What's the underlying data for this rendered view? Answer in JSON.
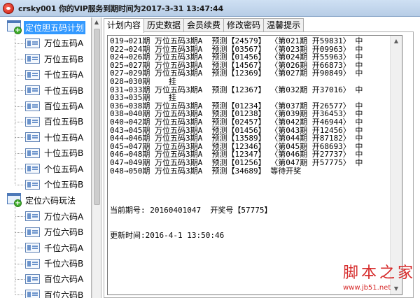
{
  "window": {
    "title": "crsky001 你的VIP服务到期时间为2017-3-31 13:47:44",
    "icon": "app-logo-icon"
  },
  "tree": {
    "groups": [
      {
        "label": "定位胆五码计划",
        "selected": true,
        "items": [
          "万位五码A",
          "万位五码B",
          "千位五码A",
          "千位五码B",
          "百位五码A",
          "百位五码B",
          "十位五码A",
          "十位五码B",
          "个位五码A",
          "个位五码B"
        ]
      },
      {
        "label": "定位六码玩法",
        "selected": false,
        "items": [
          "万位六码A",
          "万位六码B",
          "千位六码A",
          "千位六码B",
          "百位六码A",
          "百位六码B"
        ]
      }
    ]
  },
  "tabs": [
    "计划内容",
    "历史数据",
    "会员续费",
    "修改密码",
    "温馨提示"
  ],
  "plan": {
    "lines": [
      "019→021期 万位五码3期A  预测【24579】 〈第021期 开59831〉 中",
      "022→024期 万位五码3期A  预测【03567】 〈第023期 开09963〉 中",
      "024→026期 万位五码3期A  预测【01456】 〈第024期 开55963〉 中",
      "025→027期 万位五码3期A  预测【14567】 〈第026期 开66873〉 中",
      "027→029期 万位五码3期A  预测【12369】 〈第027期 开90849〉 中",
      "028→030期    挂",
      "031→033期 万位五码3期A  预测【12367】 〈第032期 开37016〉 中",
      "033→035期    挂",
      "036→038期 万位五码3期A  预测【01234】 〈第037期 开26577〉 中",
      "038→040期 万位五码3期A  预测【01238】 〈第039期 开36453〉 中",
      "040→042期 万位五码3期A  预测【02457】 〈第042期 开46944〉 中",
      "043→045期 万位五码3期A  预测【01456】 〈第043期 开12456〉 中",
      "044→046期 万位五码3期A  预测【13589】 〈第044期 开87182〉 中",
      "045→047期 万位五码3期A  预测【12346】 〈第045期 开68693〉 中",
      "046→048期 万位五码3期A  预测【12347】 〈第046期 开27737〉 中",
      "047→049期 万位五码3期A  预测【01256】 〈第047期 开57775〉 中",
      "048→050期 万位五码3期A  预测【34689】 等待开奖"
    ],
    "current_issue": "当前期号: 20160401047  开奖号【57775】",
    "update_time": "更新时间:2016-4-1 13:50:46"
  },
  "watermark": {
    "text": "脚本之家",
    "url": "www.jb51.net"
  },
  "colors": {
    "selection": "#3399ff",
    "watermark": "#d62b2b"
  }
}
